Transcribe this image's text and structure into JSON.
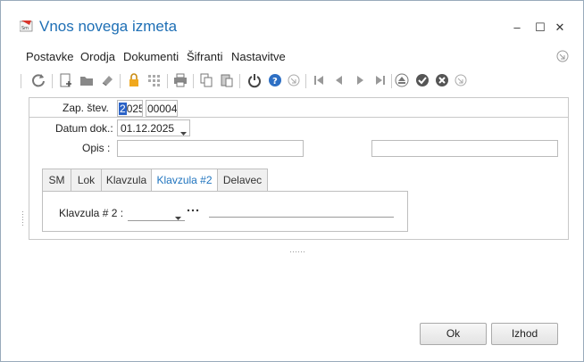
{
  "window": {
    "title": "Vnos novega izmeta",
    "minimize": "–",
    "maximize": "☐",
    "close": "✕"
  },
  "menu": {
    "items": [
      "Postavke",
      "Orodja",
      "Dokumenti",
      "Šifranti",
      "Nastavitve"
    ]
  },
  "toolbar": {
    "icons": [
      "refresh-icon",
      "new-document-icon",
      "open-folder-icon",
      "eraser-icon",
      "lock-icon",
      "grid-icon",
      "print-icon",
      "copy-icon",
      "paste-icon",
      "power-icon",
      "help-icon",
      "arrow-circle-icon",
      "first-record-icon",
      "prev-record-icon",
      "next-record-icon",
      "last-record-icon",
      "eject-icon",
      "confirm-icon",
      "cancel-icon",
      "arrow-circle-icon"
    ]
  },
  "form": {
    "zap_label": "Zap. štev.",
    "zap_year": "2025",
    "zap_year_first": "2",
    "zap_year_rest": "025",
    "zap_number": "00004",
    "datum_label": "Datum dok.:",
    "datum_value": "01.12.2025",
    "opis_label": "Opis :",
    "opis_value": "",
    "opis2_value": ""
  },
  "tabs": {
    "items": [
      "SM",
      "Lok",
      "Klavzula",
      "Klavzula #2",
      "Delavec"
    ],
    "active": "Klavzula #2"
  },
  "panel": {
    "klavzula_label": "Klavzula # 2 :",
    "klavzula_value": "",
    "klavzula_desc": ""
  },
  "buttons": {
    "ok": "Ok",
    "izhod": "Izhod"
  },
  "colors": {
    "title": "#1e6fb5",
    "active_tab": "#1e73be",
    "selection": "#2b63c7"
  }
}
